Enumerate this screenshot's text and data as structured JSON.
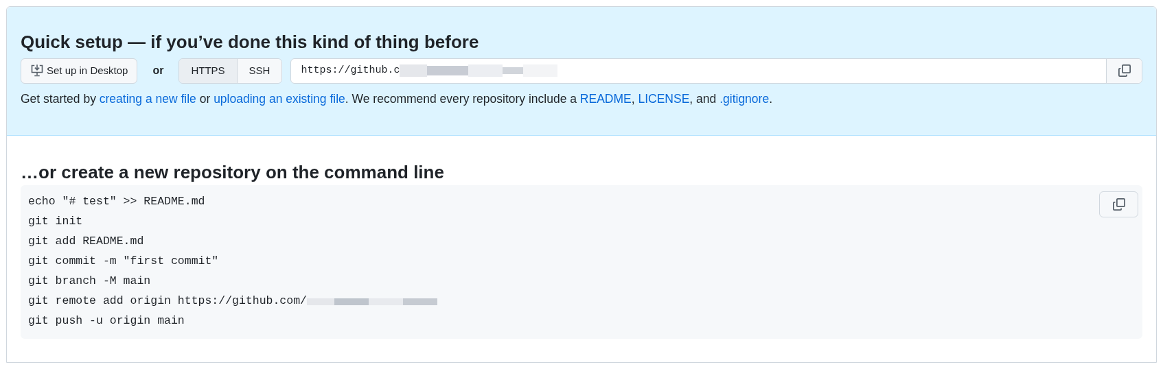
{
  "quick_setup": {
    "title": "Quick setup — if you’ve done this kind of thing before",
    "desktop_button": "Set up in Desktop",
    "or": "or",
    "protocols": [
      {
        "label": "HTTPS",
        "selected": true
      },
      {
        "label": "SSH",
        "selected": false
      }
    ],
    "url": "https://github.c",
    "hint": [
      {
        "text": "Get started by ",
        "link": false
      },
      {
        "text": "creating a new file",
        "link": true
      },
      {
        "text": " or ",
        "link": false
      },
      {
        "text": "uploading an existing file",
        "link": true
      },
      {
        "text": ". We recommend every repository include a ",
        "link": false
      },
      {
        "text": "README",
        "link": true
      },
      {
        "text": ", ",
        "link": false
      },
      {
        "text": "LICENSE",
        "link": true
      },
      {
        "text": ", and ",
        "link": false
      },
      {
        "text": ".gitignore",
        "link": true
      },
      {
        "text": ".",
        "link": false
      }
    ]
  },
  "command_line": {
    "title": "…or create a new repository on the command line",
    "lines": [
      {
        "text": "echo \"# test\" >> README.md",
        "redacted": false
      },
      {
        "text": "git init",
        "redacted": false
      },
      {
        "text": "git add README.md",
        "redacted": false
      },
      {
        "text": "git commit -m \"first commit\"",
        "redacted": false
      },
      {
        "text": "git branch -M main",
        "redacted": false
      },
      {
        "text": "git remote add origin https://github.com/",
        "redacted": true
      },
      {
        "text": "git push -u origin main",
        "redacted": false
      }
    ]
  }
}
